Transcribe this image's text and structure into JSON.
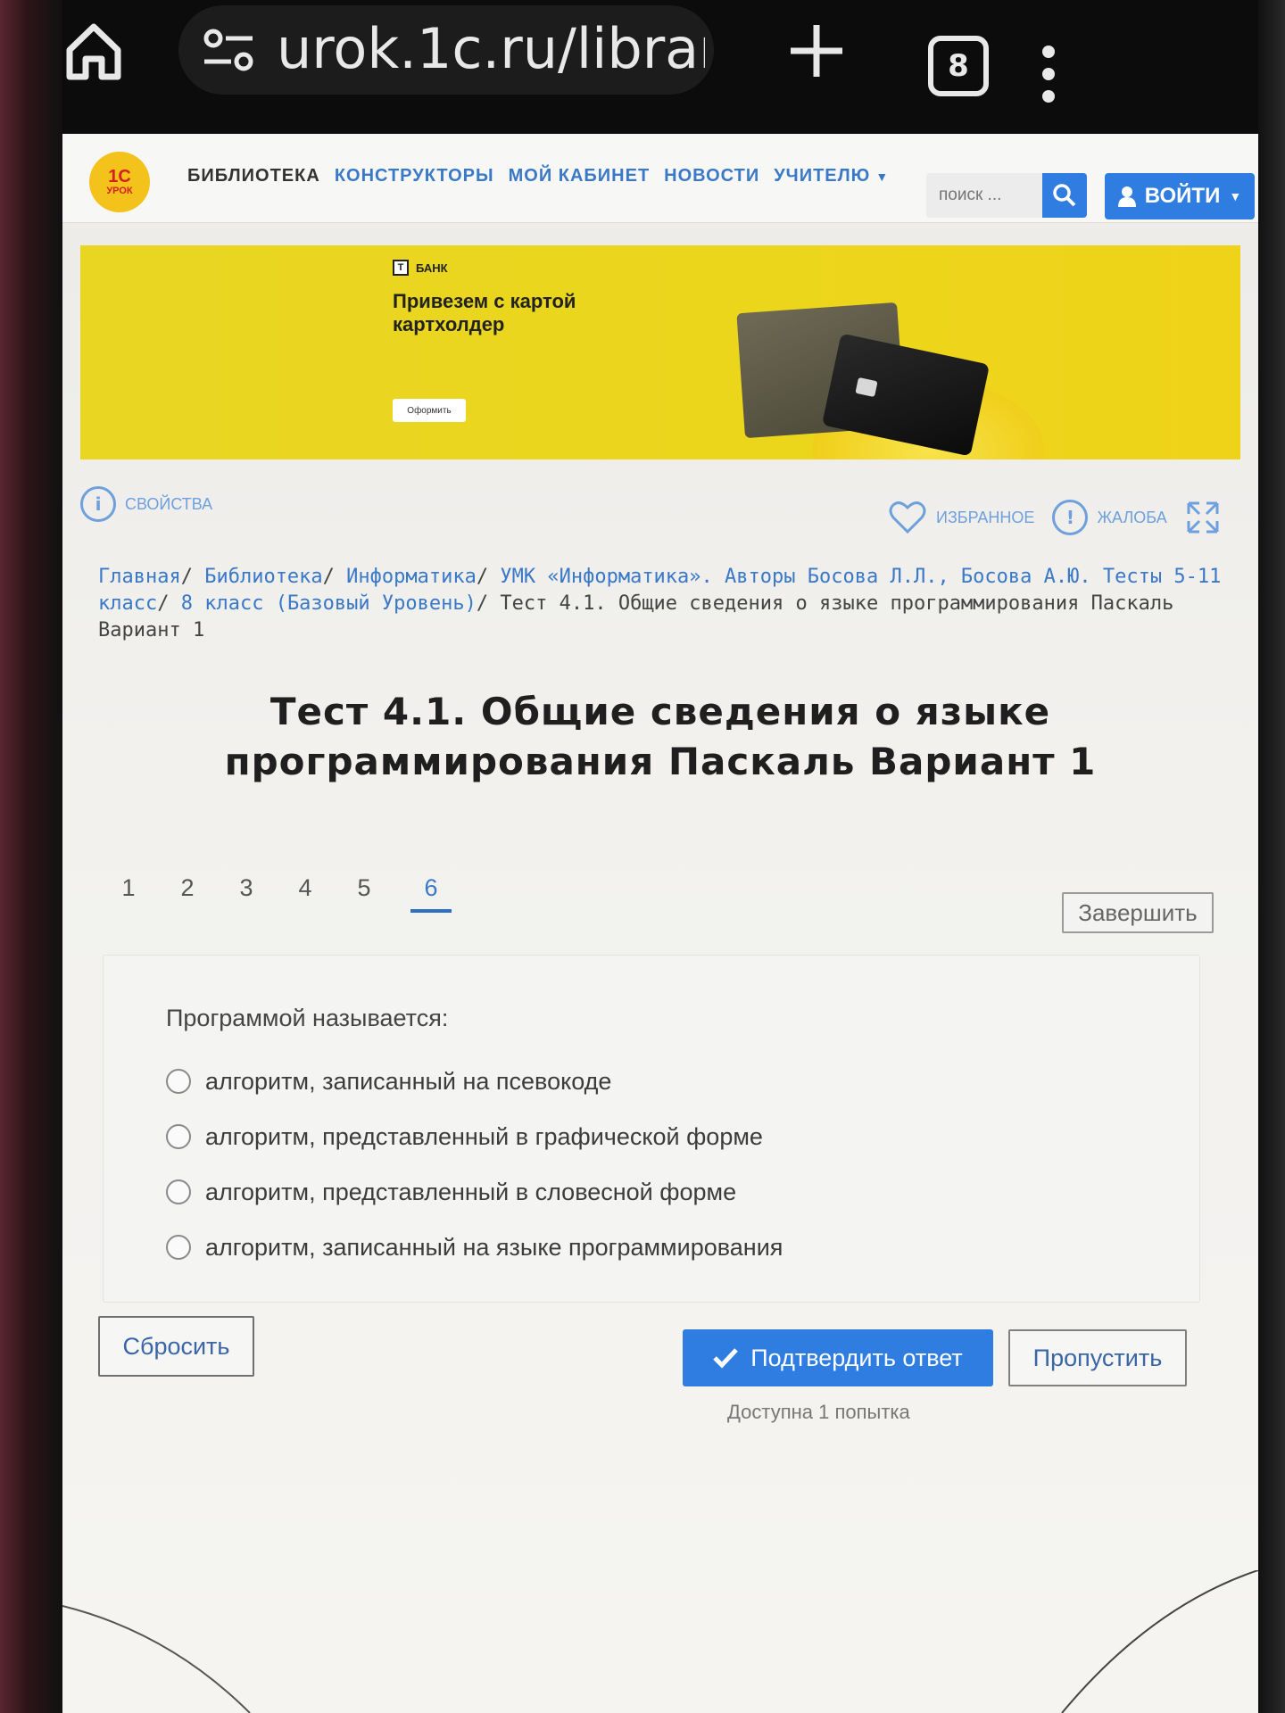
{
  "browser": {
    "url": "urok.1c.ru/librar",
    "tab_count": "8",
    "icons": [
      "home-icon",
      "site-settings-icon",
      "new-tab-icon",
      "tabs-icon",
      "more-menu-icon"
    ]
  },
  "site": {
    "logo_line1": "1С",
    "logo_line2": "УРОК",
    "nav": [
      {
        "label": "БИБЛИОТЕКА"
      },
      {
        "label": "КОНСТРУКТОРЫ"
      },
      {
        "label": "МОЙ КАБИНЕТ"
      },
      {
        "label": "НОВОСТИ"
      },
      {
        "label": "УЧИТЕЛЮ"
      }
    ],
    "search_placeholder": "поиск ...",
    "login_label": "ВОЙТИ"
  },
  "banner": {
    "brand": "БАНК",
    "headline": "Привезем с картой картхолдер",
    "button": "Оформить"
  },
  "toolbar": {
    "properties": "СВОЙСТВА",
    "favorite": "ИЗБРАННОЕ",
    "complaint": "ЖАЛОБА"
  },
  "breadcrumb": {
    "links": [
      "Главная",
      "Библиотека",
      "Информатика",
      "УМК «Информатика». Авторы Босова Л.Л., Босова А.Ю. Тесты 5-11 класс",
      "8 класс (Базовый Уровень)"
    ],
    "current": "Тест 4.1. Общие сведения о языке программирования Паскаль Вариант 1"
  },
  "test": {
    "title": "Тест 4.1. Общие сведения о языке программирования Паскаль Вариант 1",
    "questions": [
      "1",
      "2",
      "3",
      "4",
      "5",
      "6"
    ],
    "active_question": 6,
    "finish_label": "Завершить",
    "question_text": "Программой называется:",
    "options": [
      "алгоритм, записанный на псевокоде",
      "алгоритм, представленный в графической форме",
      "алгоритм, представленный в словесной форме",
      "алгоритм, записанный на языке программирования"
    ],
    "reset_label": "Сбросить",
    "confirm_label": "Подтвердить ответ",
    "skip_label": "Пропустить",
    "attempts_text": "Доступна 1 попытка"
  },
  "colors": {
    "accent": "#2f7de1",
    "link": "#3a78c8",
    "banner": "#ecd61c",
    "logo": "#f3c21b"
  }
}
